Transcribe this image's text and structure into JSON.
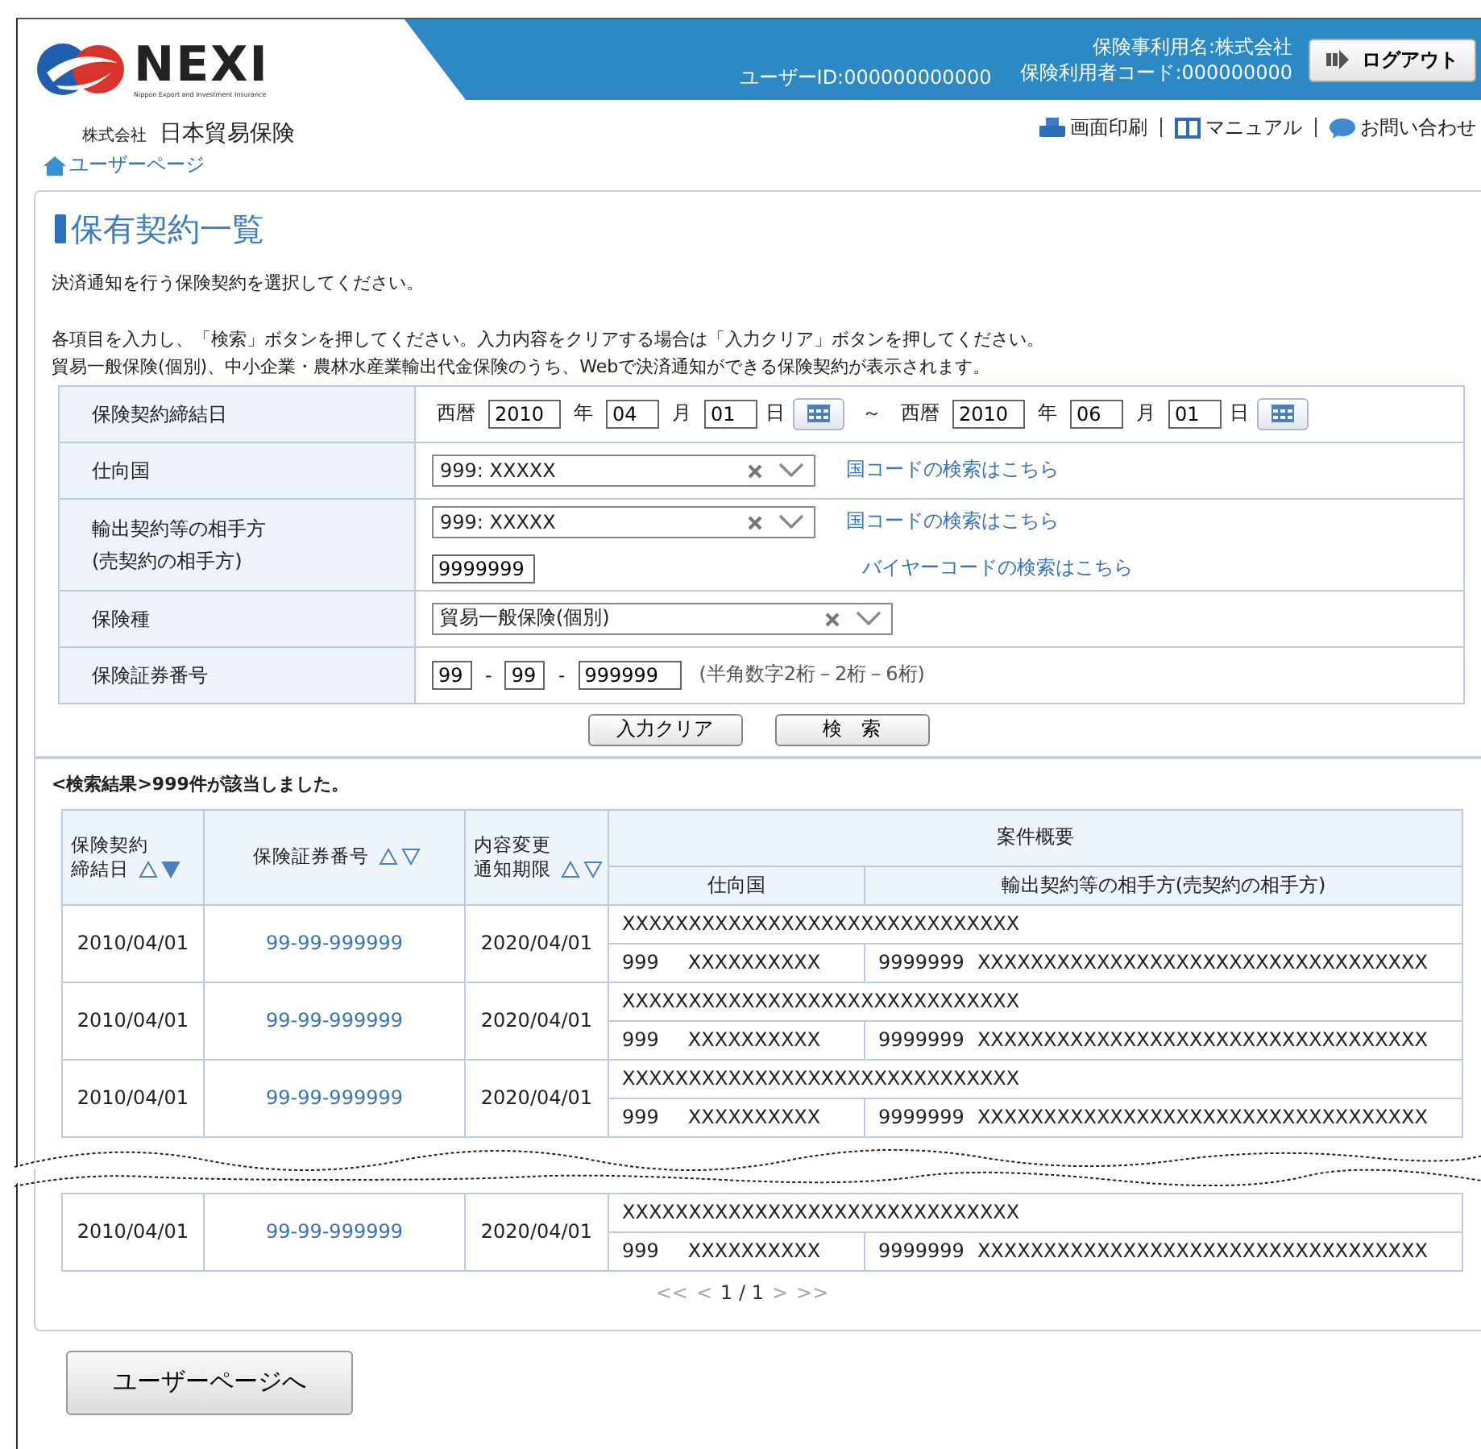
{
  "header": {
    "logo_text": "NEXI",
    "logo_subtitle": "Nippon Export and Investment Insurance",
    "company_prefix": "株式会社",
    "company_name": "日本貿易保険",
    "user_id": "ユーザーID:000000000000",
    "user_name": "保険事利用名:株式会社",
    "user_code": "保険利用者コード:000000000",
    "logout": "ログアウト"
  },
  "links": [
    {
      "kind": "print",
      "label": "画面印刷"
    },
    {
      "kind": "manual",
      "label": "マニュアル"
    },
    {
      "kind": "contact",
      "label": "お問い合わせ"
    }
  ],
  "breadcrumb": "ユーザーページ",
  "title": "保有契約一覧",
  "intro": [
    "決済通知を行う保険契約を選択してください。",
    "各項目を入力し、「検索」ボタンを押してください。入力内容をクリアする場合は「入力クリア」ボタンを押してください。",
    "貿易一般保険(個別)、中小企業・農林水産業輸出代金保険のうち、Webで決済通知ができる保険契約が表示されます。"
  ],
  "form": [
    {
      "kind": "date_range",
      "label_lines": [
        "保険契約締結日"
      ],
      "from": {
        "era": "西暦",
        "year": "2010",
        "year_unit": "年",
        "month": "04",
        "month_unit": "月",
        "day": "01",
        "day_unit": "日"
      },
      "separator": "～",
      "to": {
        "era": "西暦",
        "year": "2010",
        "year_unit": "年",
        "month": "06",
        "month_unit": "月",
        "day": "01",
        "day_unit": "日"
      }
    },
    {
      "kind": "select",
      "label_lines": [
        "仕向国"
      ],
      "value": "999: XXXXX",
      "link": "国コードの検索はこちら"
    },
    {
      "kind": "select_code",
      "label_lines": [
        "輸出契約等の相手方",
        "(売契約の相手方)"
      ],
      "value": "999: XXXXX",
      "link": "国コードの検索はこちら",
      "code": "9999999",
      "code_link": "バイヤーコードの検索はこちら"
    },
    {
      "kind": "select_wide",
      "label_lines": [
        "保険種"
      ],
      "value": "貿易一般保険(個別)"
    },
    {
      "kind": "policy",
      "label_lines": [
        "保険証券番号"
      ],
      "parts": [
        "99",
        "99",
        "999999"
      ],
      "separator": "-",
      "hint": "(半角数字2桁－2桁－6桁)"
    }
  ],
  "buttons": [
    "入力クリア",
    "検　索"
  ],
  "result_summary": "<検索結果>999件が該当しました。",
  "table": {
    "columns": [
      {
        "label_lines": [
          "保険契約",
          "締結日"
        ],
        "sort_up_active": false,
        "sort_down_active": true
      },
      {
        "label_lines": [
          "保険証券番号"
        ],
        "sort_up_active": false,
        "sort_down_active": false
      },
      {
        "label_lines": [
          "内容変更",
          "通知期限"
        ],
        "sort_up_active": false,
        "sort_down_active": false
      }
    ],
    "group": "案件概要",
    "sub_columns": [
      "仕向国",
      "輸出契約等の相手方(売契約の相手方)"
    ],
    "rows": [
      {
        "date": "2010/04/01",
        "policy_no": "99-99-999999",
        "deadline": "2020/04/01",
        "summary": "XXXXXXXXXXXXXXXXXXXXXXXXXXXXXX",
        "country_code": "999",
        "country": "XXXXXXXXXX",
        "partner_code": "9999999",
        "partner": "XXXXXXXXXXXXXXXXXXXXXXXXXXXXXXXXXX",
        "tear_before": false
      },
      {
        "date": "2010/04/01",
        "policy_no": "99-99-999999",
        "deadline": "2020/04/01",
        "summary": "XXXXXXXXXXXXXXXXXXXXXXXXXXXXXX",
        "country_code": "999",
        "country": "XXXXXXXXXX",
        "partner_code": "9999999",
        "partner": "XXXXXXXXXXXXXXXXXXXXXXXXXXXXXXXXXX",
        "tear_before": false
      },
      {
        "date": "2010/04/01",
        "policy_no": "99-99-999999",
        "deadline": "2020/04/01",
        "summary": "XXXXXXXXXXXXXXXXXXXXXXXXXXXXXX",
        "country_code": "999",
        "country": "XXXXXXXXXX",
        "partner_code": "9999999",
        "partner": "XXXXXXXXXXXXXXXXXXXXXXXXXXXXXXXXXX",
        "tear_before": false
      },
      {
        "date": "2010/04/01",
        "policy_no": "99-99-999999",
        "deadline": "2020/04/01",
        "summary": "XXXXXXXXXXXXXXXXXXXXXXXXXXXXXX",
        "country_code": "999",
        "country": "XXXXXXXXXX",
        "partner_code": "9999999",
        "partner": "XXXXXXXXXXXXXXXXXXXXXXXXXXXXXXXXXX",
        "tear_before": true
      }
    ]
  },
  "pagination": {
    "first": "<<",
    "prev": "<",
    "page": "1 / 1",
    "next": ">",
    "last": ">>",
    "disabled": true
  },
  "back_button": "ユーザーページへ"
}
